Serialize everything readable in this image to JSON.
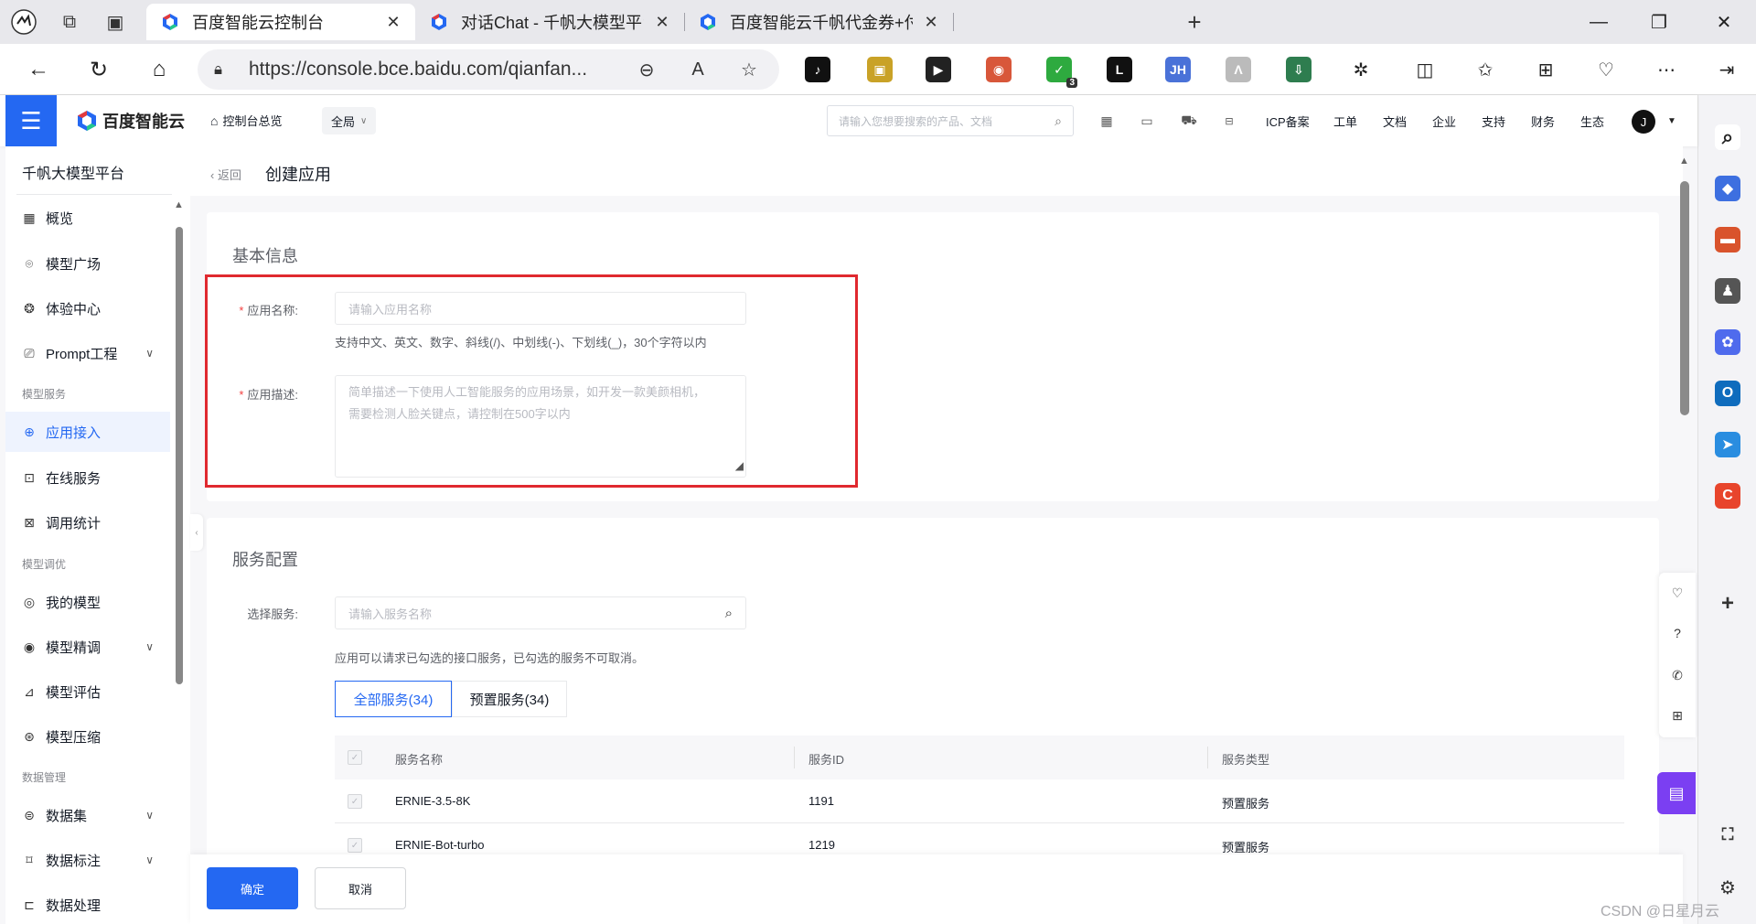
{
  "browser": {
    "tabs": [
      {
        "title": "百度智能云控制台",
        "active": true
      },
      {
        "title": "对话Chat - 千帆大模型平台 | 百度",
        "active": false
      },
      {
        "title": "百度智能云千帆代金券+付费模型",
        "active": false
      }
    ],
    "url": "https://console.bce.baidu.com/qianfan...",
    "extensions": [
      {
        "icon": "tiktok-icon",
        "color": "#111111",
        "glyph": "♪"
      },
      {
        "icon": "image-ext-icon",
        "color": "#c9a227",
        "glyph": "▣"
      },
      {
        "icon": "play-icon",
        "color": "#222222",
        "glyph": "▶"
      },
      {
        "icon": "mask-ext-icon",
        "color": "#d8573a",
        "glyph": "◉"
      },
      {
        "icon": "shield-ext-icon",
        "color": "#2eaa3f",
        "glyph": "✓",
        "badge": "3"
      },
      {
        "icon": "l-ext-icon",
        "color": "#111111",
        "glyph": "L"
      },
      {
        "icon": "jh-ext-icon",
        "color": "#4a72d8",
        "glyph": "JH"
      },
      {
        "icon": "a-ext-icon",
        "color": "#bbbbbb",
        "glyph": "Λ"
      },
      {
        "icon": "download-ext-icon",
        "color": "#2e7d4f",
        "glyph": "⇩"
      }
    ]
  },
  "header": {
    "logo": "百度智能云",
    "console_overview": "控制台总览",
    "scope": "全局",
    "search_placeholder": "请输入您想要搜索的产品、文档",
    "links": [
      "ICP备案",
      "工单",
      "文档",
      "企业",
      "支持",
      "财务",
      "生态"
    ],
    "avatar": "J"
  },
  "sidebar": {
    "title": "千帆大模型平台",
    "items": [
      {
        "label": "概览",
        "icon": "grid-icon",
        "glyph": "▦"
      },
      {
        "label": "模型广场",
        "icon": "model-square-icon",
        "glyph": "⌾"
      },
      {
        "label": "体验中心",
        "icon": "experience-icon",
        "glyph": "❂"
      },
      {
        "label": "Prompt工程",
        "icon": "prompt-icon",
        "glyph": "⎚",
        "expandable": true
      },
      {
        "group": "模型服务"
      },
      {
        "label": "应用接入",
        "icon": "app-access-icon",
        "glyph": "⊕",
        "active": true
      },
      {
        "label": "在线服务",
        "icon": "online-service-icon",
        "glyph": "⊡"
      },
      {
        "label": "调用统计",
        "icon": "stats-icon",
        "glyph": "⊠"
      },
      {
        "group": "模型调优"
      },
      {
        "label": "我的模型",
        "icon": "my-model-icon",
        "glyph": "◎"
      },
      {
        "label": "模型精调",
        "icon": "fine-tune-icon",
        "glyph": "◉",
        "expandable": true
      },
      {
        "label": "模型评估",
        "icon": "evaluate-icon",
        "glyph": "⊿"
      },
      {
        "label": "模型压缩",
        "icon": "compress-icon",
        "glyph": "⊛"
      },
      {
        "group": "数据管理"
      },
      {
        "label": "数据集",
        "icon": "dataset-icon",
        "glyph": "⊜",
        "expandable": true
      },
      {
        "label": "数据标注",
        "icon": "annotate-icon",
        "glyph": "⌑",
        "expandable": true
      },
      {
        "label": "数据处理",
        "icon": "process-icon",
        "glyph": "⊏"
      }
    ]
  },
  "page": {
    "back": "返回",
    "title": "创建应用"
  },
  "basic_info": {
    "title": "基本信息",
    "name_label": "应用名称:",
    "name_placeholder": "请输入应用名称",
    "name_hint": "支持中文、英文、数字、斜线(/)、中划线(-)、下划线(_)，30个字符以内",
    "desc_label": "应用描述:",
    "desc_placeholder_line1": "简单描述一下使用人工智能服务的应用场景，如开发一款美颜相机，",
    "desc_placeholder_line2": "需要检测人脸关键点，请控制在500字以内"
  },
  "service_config": {
    "title": "服务配置",
    "select_label": "选择服务:",
    "search_placeholder": "请输入服务名称",
    "hint": "应用可以请求已勾选的接口服务，已勾选的服务不可取消。",
    "tabs": [
      {
        "label": "全部服务(34)",
        "active": true
      },
      {
        "label": "预置服务(34)",
        "active": false
      }
    ],
    "columns": [
      "服务名称",
      "服务ID",
      "服务类型"
    ],
    "rows": [
      {
        "name": "ERNIE-3.5-8K",
        "id": "1191",
        "type": "预置服务"
      },
      {
        "name": "ERNIE-Bot-turbo",
        "id": "1219",
        "type": "预置服务"
      }
    ]
  },
  "footer": {
    "confirm": "确定",
    "cancel": "取消"
  },
  "edge_sidebar": [
    {
      "icon": "search-icon",
      "color": "#ffffff",
      "glyph": "⌕",
      "fg": "#222222"
    },
    {
      "icon": "tag-icon",
      "color": "#3d6fe0",
      "glyph": "◆"
    },
    {
      "icon": "toolbox-icon",
      "color": "#d9532c",
      "glyph": "▬"
    },
    {
      "icon": "chess-icon",
      "color": "#555555",
      "glyph": "♟"
    },
    {
      "icon": "copilot-icon",
      "color": "#4f6bed",
      "glyph": "✿"
    },
    {
      "icon": "outlook-icon",
      "color": "#0f6cbd",
      "glyph": "O"
    },
    {
      "icon": "send-icon",
      "color": "#2a8de0",
      "glyph": "➤"
    },
    {
      "icon": "c-app-icon",
      "color": "#e8452c",
      "glyph": "C"
    }
  ],
  "watermark": "CSDN @日星月云"
}
